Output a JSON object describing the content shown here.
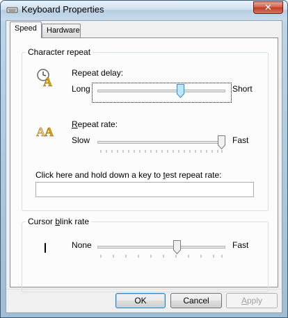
{
  "window": {
    "title": "Keyboard Properties",
    "close_label": "✕"
  },
  "tabs": [
    {
      "label": "Speed",
      "active": true
    },
    {
      "label": "Hardware",
      "active": false
    }
  ],
  "character_repeat": {
    "title": "Character repeat",
    "repeat_delay": {
      "label_pre": "",
      "label_mnemonic": "",
      "label": "Repeat delay:",
      "min_label": "Long",
      "max_label": "Short",
      "value_fraction": 0.66
    },
    "repeat_rate": {
      "mnemonic": "R",
      "label_rest": "epeat rate:",
      "min_label": "Slow",
      "max_label": "Fast",
      "value_fraction": 1.0
    },
    "test_prompt_pre": "Click here and hold down a key to ",
    "test_prompt_mnemonic": "t",
    "test_prompt_post": "est repeat rate:",
    "test_value": ""
  },
  "cursor_blink": {
    "title_pre": "Cursor ",
    "title_mnemonic": "b",
    "title_post": "link rate",
    "min_label": "None",
    "max_label": "Fast",
    "value_fraction": 0.63
  },
  "buttons": {
    "ok": "OK",
    "cancel": "Cancel",
    "apply_mnemonic": "A",
    "apply_rest": "pply"
  },
  "colors": {
    "thumb_focus": "#5bc0e8",
    "close_button": "#c13c23"
  }
}
